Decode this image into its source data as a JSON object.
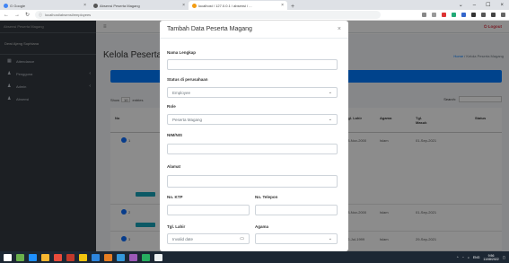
{
  "browser": {
    "tabs": [
      {
        "label": "G Google",
        "close": "×"
      },
      {
        "label": "Absensi Peserta Magang",
        "close": "×"
      },
      {
        "label": "localhost / 127.0.0.1 / absensi / ...",
        "close": "×"
      }
    ],
    "new_tab": "+",
    "window_controls": {
      "minimize": "–",
      "maximize": "☐",
      "close": "×",
      "dropdown": "⌄"
    },
    "address": "localhost/absensi/employees"
  },
  "sidebar": {
    "brand": "Absensi Peserta Magang",
    "user": "Dewi Ajeng Sophiana",
    "items": [
      {
        "label": "Attendance",
        "icon": "dashboard-icon",
        "chevron": ""
      },
      {
        "label": "Pengguna",
        "icon": "users-icon",
        "chevron": "‹"
      },
      {
        "label": "Admin",
        "icon": "users-icon",
        "chevron": "‹"
      },
      {
        "label": "Absensi",
        "icon": "users-icon",
        "chevron": ""
      }
    ]
  },
  "topnav": {
    "menu_icon": "≡",
    "logout": "Logout"
  },
  "page": {
    "title": "Kelola Peserta",
    "breadcrumb_home": "Home",
    "breadcrumb_sep": " / ",
    "breadcrumb_current": "Kelola Peserta Magang"
  },
  "table": {
    "show_label": "Show",
    "show_value": "10",
    "show_suffix": "entries",
    "search_label": "Search:",
    "headers": [
      "No",
      "Tgl. Lahir",
      "Agama",
      "Tgl. Masuk",
      "Status"
    ],
    "rows": [
      {
        "no": "1",
        "tgl_lahir": "03-Nov-2000",
        "agama": "Islam",
        "tgl_masuk": "01-Sep-2021"
      },
      {
        "no": "2",
        "tgl_lahir": "03-Nov-2000",
        "agama": "Islam",
        "tgl_masuk": "01-Sep-2021"
      },
      {
        "no": "3",
        "tgl_lahir": "22-Jul-1999",
        "agama": "Islam",
        "tgl_masuk": "29-Sep-2021"
      }
    ]
  },
  "modal": {
    "title": "Tambah Data Peserta Magang",
    "close": "×",
    "fields": {
      "nama_label": "Nama Lengkap",
      "nama_value": "",
      "status_label": "Status di perusahaan",
      "status_value": "Employee",
      "role_label": "Role",
      "role_value": "Peserta Magang",
      "nim_label": "NIM/NIS",
      "nim_value": "",
      "alamat_label": "Alamat",
      "alamat_value": "",
      "ktp_label": "No. KTP",
      "ktp_value": "",
      "telepon_label": "No. Telepon",
      "telepon_value": "",
      "lahir_label": "Tgl. Lahir",
      "lahir_value": "Invalid date",
      "agama_label": "Agama",
      "agama_value": ""
    }
  },
  "taskbar": {
    "lang": "ENG",
    "time": "9:56",
    "date": "11/08/2022"
  },
  "colors": {
    "primary": "#007bff",
    "sidebar": "#343a40",
    "logout": "#dc3545",
    "success": "#28a745"
  }
}
